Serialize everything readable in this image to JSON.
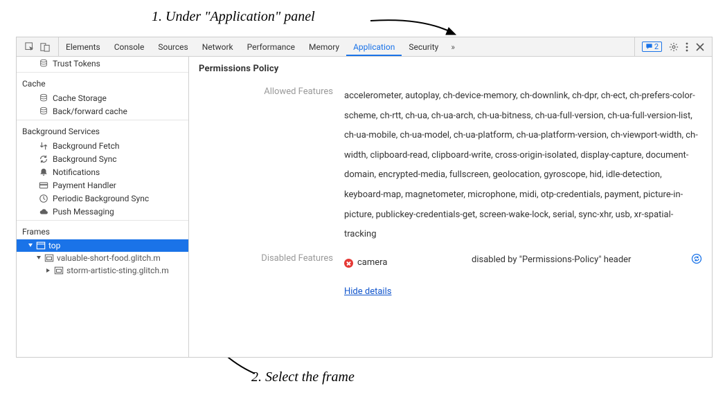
{
  "annotations": {
    "step1": "1. Under \"Application\" panel",
    "step2": "2. Select the frame"
  },
  "toolbar": {
    "issues_count": "2",
    "more_label": "»"
  },
  "tabs": {
    "elements": "Elements",
    "console": "Console",
    "sources": "Sources",
    "network": "Network",
    "performance": "Performance",
    "memory": "Memory",
    "application": "Application",
    "security": "Security"
  },
  "sidebar": {
    "trust_tokens": "Trust Tokens",
    "cache_header": "Cache",
    "cache_storage": "Cache Storage",
    "back_forward_cache": "Back/forward cache",
    "bg_header": "Background Services",
    "bg_fetch": "Background Fetch",
    "bg_sync": "Background Sync",
    "notifications": "Notifications",
    "payment_handler": "Payment Handler",
    "periodic_bg_sync": "Periodic Background Sync",
    "push_messaging": "Push Messaging",
    "frames_header": "Frames",
    "top_frame": "top",
    "frame1": "valuable-short-food.glitch.m",
    "frame2": "storm-artistic-sting.glitch.m"
  },
  "content": {
    "title": "Permissions Policy",
    "allowed_label": "Allowed Features",
    "allowed_value": "accelerometer, autoplay, ch-device-memory, ch-downlink, ch-dpr, ch-ect, ch-prefers-color-scheme, ch-rtt, ch-ua, ch-ua-arch, ch-ua-bitness, ch-ua-full-version, ch-ua-full-version-list, ch-ua-mobile, ch-ua-model, ch-ua-platform, ch-ua-platform-version, ch-viewport-width, ch-width, clipboard-read, clipboard-write, cross-origin-isolated, display-capture, document-domain, encrypted-media, fullscreen, geolocation, gyroscope, hid, idle-detection, keyboard-map, magnetometer, microphone, midi, otp-credentials, payment, picture-in-picture, publickey-credentials-get, screen-wake-lock, serial, sync-xhr, usb, xr-spatial-tracking",
    "disabled_label": "Disabled Features",
    "disabled_feature": "camera",
    "disabled_reason": "disabled by \"Permissions-Policy\" header",
    "hide_details": "Hide details"
  }
}
